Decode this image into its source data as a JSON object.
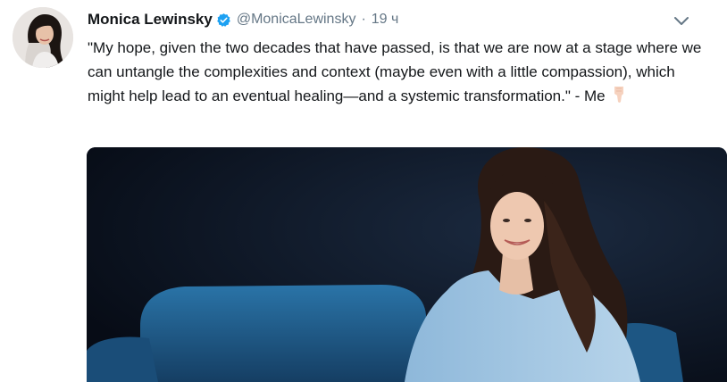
{
  "tweet": {
    "author_name": "Monica Lewinsky",
    "handle": "@MonicaLewinsky",
    "separator": "·",
    "time": "19 ч",
    "text": "\"My hope, given the two decades that have passed, is that we are now at a stage where we can untangle the complexities and context (maybe even with a little compassion), which might help lead to an eventual healing—and a systemic transformation.\" - Me",
    "emoji": "pointing-down-hand-emoji"
  },
  "colors": {
    "verified": "#1da1f2",
    "secondary_text": "#657786",
    "primary_text": "#14171a",
    "photo_background": "#0b1220",
    "sofa": "#1f5a8a",
    "dress": "#8fb9dc"
  },
  "icons": [
    "verified-badge-icon",
    "chevron-down-icon"
  ]
}
